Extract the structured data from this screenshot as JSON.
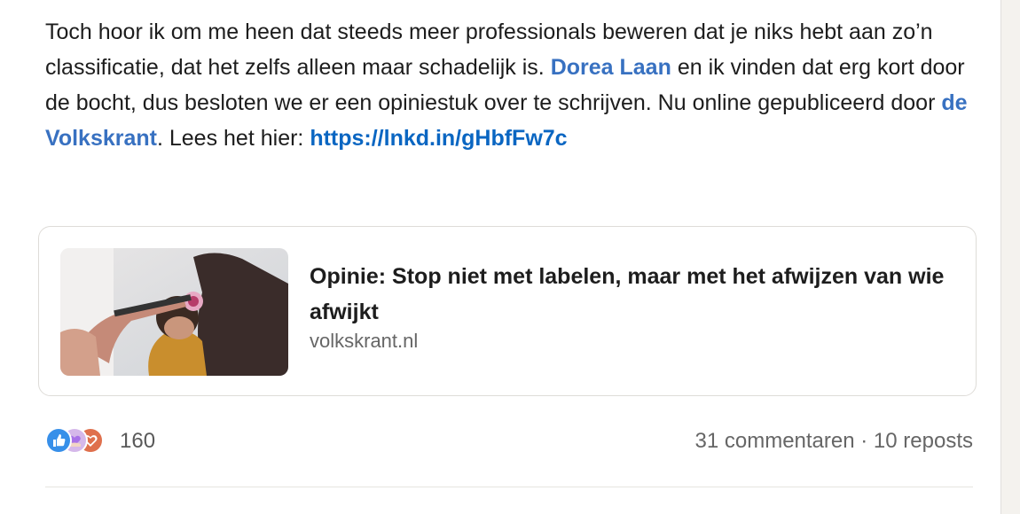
{
  "post": {
    "text_1": "Toch hoor ik om me heen dat steeds meer professionals beweren dat je niks hebt aan zo’n classificatie, dat het zelfs alleen maar schadelijk is. ",
    "mention": "Dorea Laan",
    "text_2": " en ik vinden dat erg kort door de bocht, dus besloten we er een opiniestuk over te schrijven. Nu online gepubliceerd door ",
    "publisher": "de Volkskrant",
    "text_3": ". Lees het hier: ",
    "link": "https://lnkd.in/gHbfFw7c"
  },
  "article": {
    "title": "Opinie: Stop niet met labelen, maar met het afwijzen van wie afwijkt",
    "source": "volkskrant.nl",
    "thumbnail_icon": "article-photo"
  },
  "social": {
    "reaction_icons": [
      "like-icon",
      "support-icon",
      "love-icon"
    ],
    "reaction_count": "160",
    "comments": "31 commentaren",
    "separator": " · ",
    "reposts": "10 reposts"
  },
  "colors": {
    "link": "#0a66c2",
    "like": "#378fe9",
    "love": "#df704d",
    "support": "#d5b8ea"
  }
}
